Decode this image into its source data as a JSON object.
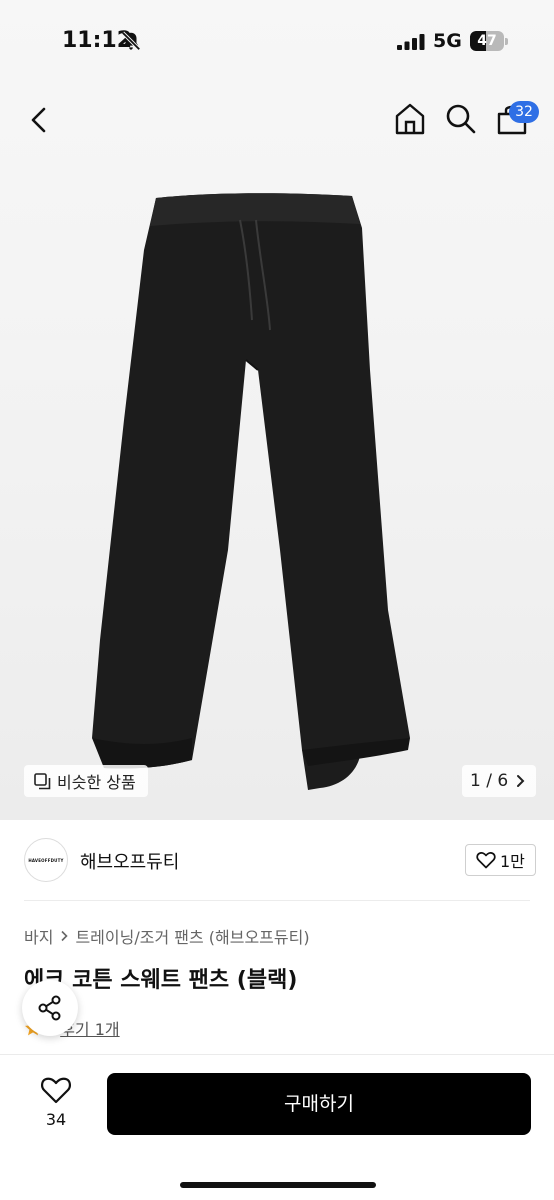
{
  "status_bar": {
    "time": "11:12",
    "network": "5G",
    "battery": "47",
    "battery_level": 0.47
  },
  "header": {
    "cart_count": "32"
  },
  "gallery": {
    "similar_label": "비슷한 상품",
    "pager": "1 / 6"
  },
  "brand": {
    "logo_text": "HAVEOFFDUTY",
    "name": "해브오프듀티",
    "likes": "1만"
  },
  "breadcrumb": [
    "바지",
    "트레이닝/조거 팬츠 (해브오프듀티)"
  ],
  "product": {
    "title": "에크 코튼 스웨트 팬츠 (블랙)",
    "rating": "5",
    "review_label": "후기 1개"
  },
  "bottom_bar": {
    "wish_count": "34",
    "buy_label": "구매하기"
  },
  "colors": {
    "accent_badge": "#2f6fe5",
    "buy_button": "#000000",
    "star": "#f5a623"
  }
}
